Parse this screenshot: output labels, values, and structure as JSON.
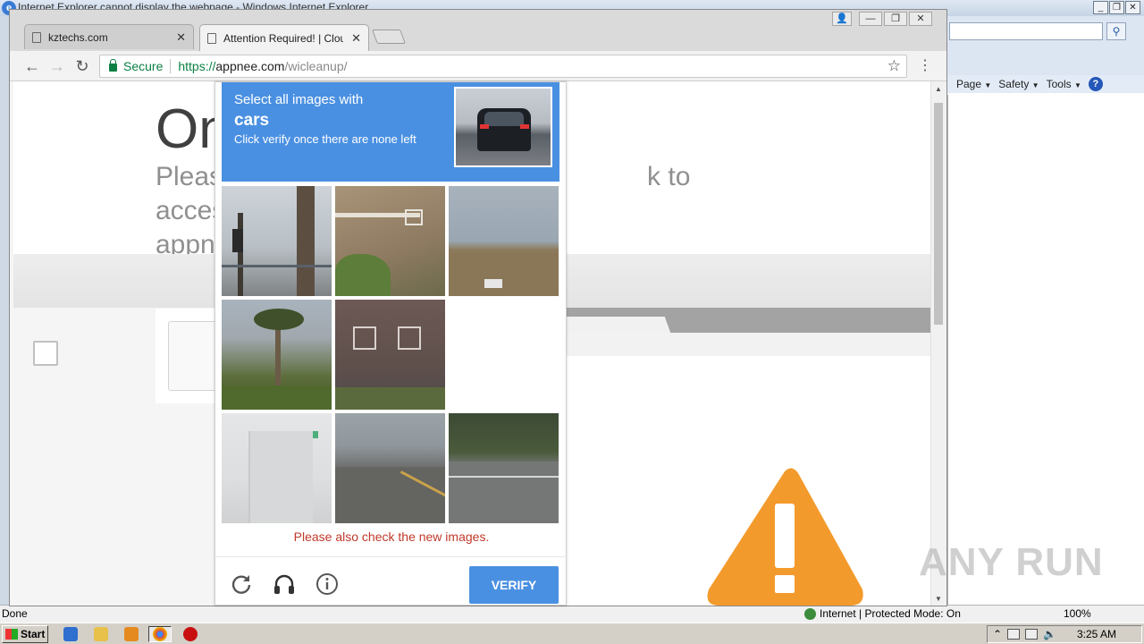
{
  "ie": {
    "window_title": "Internet Explorer cannot display the webpage - Windows Internet Explorer",
    "menu": [
      "Page",
      "Safety",
      "Tools"
    ],
    "status_left": "Done",
    "status_zone": "Internet | Protected Mode: On",
    "zoom": "100%"
  },
  "taskbar": {
    "start_label": "Start",
    "time": "3:25 AM"
  },
  "chrome": {
    "tabs": [
      {
        "title": "kztechs.com"
      },
      {
        "title": "Attention Required! | Cloudflare"
      }
    ],
    "secure_label": "Secure",
    "url": {
      "scheme": "https://",
      "host": "appnee.com",
      "path": "/wicleanup/"
    }
  },
  "page": {
    "title": "On",
    "subtitle_left": "Pleas",
    "subtitle_right": "k to access",
    "subtitle_line2": "appn"
  },
  "captcha": {
    "line1": "Select all images with",
    "target": "cars",
    "line3": "Click verify once there are none left",
    "error": "Please also check the new images.",
    "verify_label": "VERIFY",
    "icons": [
      "reload-icon",
      "headphones-icon",
      "info-icon"
    ]
  },
  "watermark": "ANY RUN",
  "colors": {
    "captcha_blue": "#4a90e2",
    "secure_green": "#0b8043",
    "error_red": "#c0392b",
    "warning_orange": "#f39a2c"
  }
}
